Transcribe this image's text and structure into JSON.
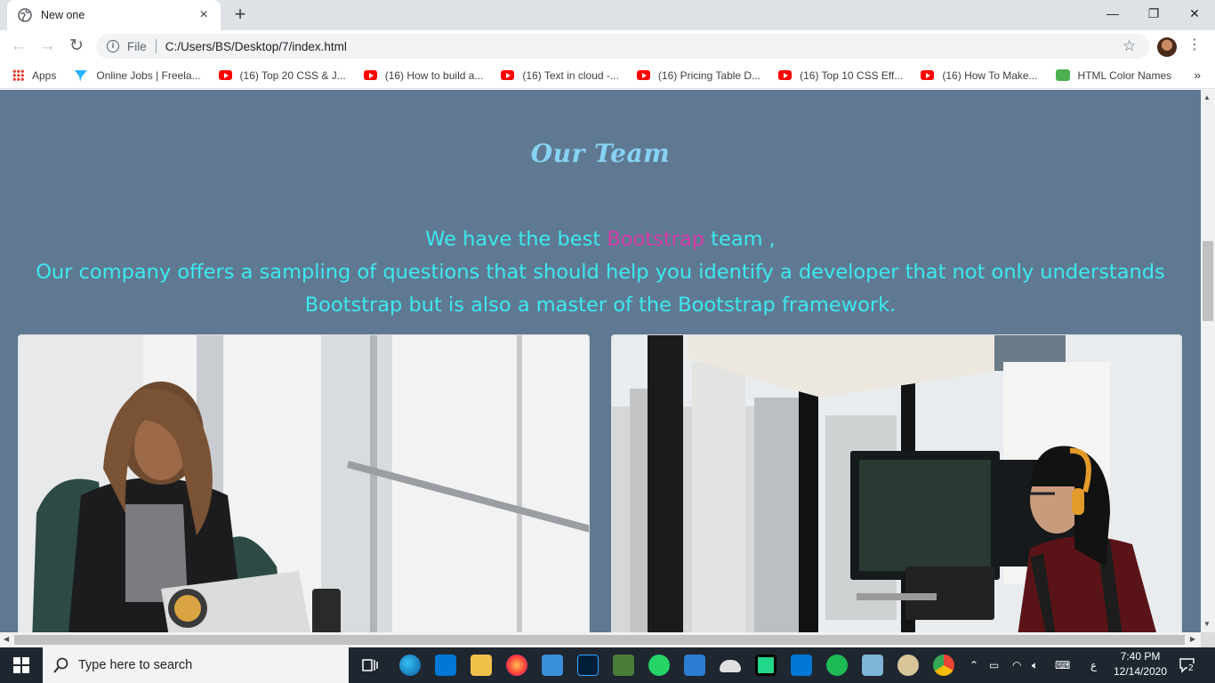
{
  "browser": {
    "tab_title": "New one",
    "tab_close": "×",
    "new_tab": "+",
    "win_min": "—",
    "win_restore": "❐",
    "win_close": "✕",
    "omnibox_scheme": "File",
    "omnibox_url": "C:/Users/BS/Desktop/7/index.html",
    "bookmarks": [
      {
        "label": "Apps",
        "icon": "apps-grid-icon"
      },
      {
        "label": "Online Jobs | Freela...",
        "icon": "freelancer-icon"
      },
      {
        "label": "(16) Top 20 CSS & J...",
        "icon": "youtube-icon"
      },
      {
        "label": "(16) How to build a...",
        "icon": "youtube-icon"
      },
      {
        "label": "(16) Text in cloud -...",
        "icon": "youtube-icon"
      },
      {
        "label": "(16) Pricing Table D...",
        "icon": "youtube-icon"
      },
      {
        "label": "(16) Top 10 CSS Eff...",
        "icon": "youtube-icon"
      },
      {
        "label": "(16) How To Make...",
        "icon": "youtube-icon"
      },
      {
        "label": "HTML Color Names",
        "icon": "w3schools-icon"
      }
    ],
    "bookmarks_more": "»"
  },
  "page": {
    "title": "Our Team",
    "lead_line1_before": "We have the best ",
    "lead_line1_highlight": "Bootstrap",
    "lead_line1_after": " team ,",
    "lead_line2": "Our company offers a sampling of questions that should help you identify a developer that not only understands",
    "lead_line3": "Bootstrap but is also a master of the Bootstrap framework.",
    "colors": {
      "background": "#5f7993",
      "title": "#86d2f4",
      "lead": "#3ee8f0",
      "highlight": "#d53aa8"
    }
  },
  "taskbar": {
    "search_placeholder": "Type here to search",
    "time": "7:40 PM",
    "date": "12/14/2020",
    "lang": "ع",
    "notifications": "2"
  }
}
